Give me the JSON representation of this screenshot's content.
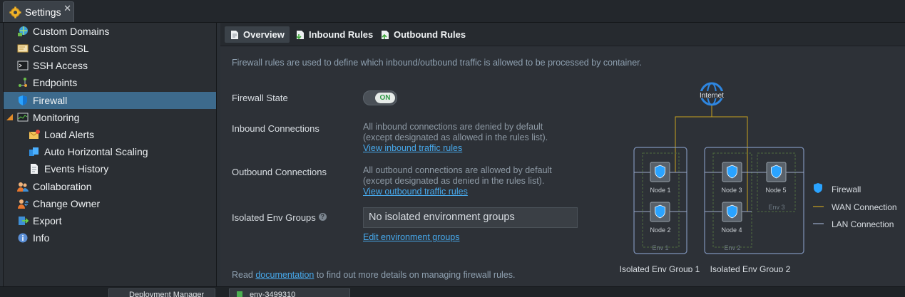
{
  "window": {
    "title": "Settings"
  },
  "sidebar": {
    "items": [
      {
        "label": "Custom Domains",
        "icon": "globe-network-icon"
      },
      {
        "label": "Custom SSL",
        "icon": "certificate-icon"
      },
      {
        "label": "SSH Access",
        "icon": "terminal-icon"
      },
      {
        "label": "Endpoints",
        "icon": "endpoints-icon"
      },
      {
        "label": "Firewall",
        "icon": "shield-icon",
        "active": true
      },
      {
        "label": "Monitoring",
        "icon": "monitor-chart-icon"
      },
      {
        "label": "Load Alerts",
        "icon": "envelope-alert-icon"
      },
      {
        "label": "Auto Horizontal Scaling",
        "icon": "scaling-icon"
      },
      {
        "label": "Events History",
        "icon": "document-icon"
      },
      {
        "label": "Collaboration",
        "icon": "users-icon"
      },
      {
        "label": "Change Owner",
        "icon": "user-transfer-icon"
      },
      {
        "label": "Export",
        "icon": "export-icon"
      },
      {
        "label": "Info",
        "icon": "info-icon"
      }
    ]
  },
  "tabs": [
    {
      "label": "Overview",
      "active": true
    },
    {
      "label": "Inbound Rules"
    },
    {
      "label": "Outbound Rules"
    }
  ],
  "overview": {
    "description": "Firewall rules are used to define which inbound/outbound traffic is allowed to be processed by container.",
    "firewall_state": {
      "label": "Firewall State",
      "toggle": "ON"
    },
    "inbound": {
      "label": "Inbound Connections",
      "line1": "All inbound connections are denied by default",
      "line2": "(except designated as allowed in the rules list).",
      "link": "View inbound traffic rules"
    },
    "outbound": {
      "label": "Outbound Connections",
      "line1": "All outbound connections are allowed by default",
      "line2": "(except designated as denied in the rules list).",
      "link": "View outbound traffic rules"
    },
    "isolated": {
      "label": "Isolated Env Groups",
      "value": "No isolated environment groups",
      "link": "Edit environment groups"
    },
    "footer": {
      "prefix": "Read ",
      "link": "documentation",
      "suffix": " to find out more details on managing firewall rules."
    }
  },
  "diagram": {
    "internet": "Internet",
    "nodes": [
      "Node 1",
      "Node 2",
      "Node 3",
      "Node 4",
      "Node 5"
    ],
    "envs": [
      "Env 1",
      "Env 2",
      "Env 3"
    ],
    "groups": [
      "Isolated Env Group 1",
      "Isolated Env Group 2"
    ],
    "legend": {
      "firewall": "Firewall",
      "wan": "WAN Connection",
      "lan": "LAN Connection"
    },
    "colors": {
      "wan": "#c9a21f",
      "lan": "#9aa9c7",
      "firewall": "#1e88e5",
      "group_border": "#7e92b8",
      "env_border": "#5e7a4a"
    }
  },
  "bottom_tabs": [
    {
      "label": "Deployment Manager"
    },
    {
      "label": "env-3499310"
    }
  ]
}
